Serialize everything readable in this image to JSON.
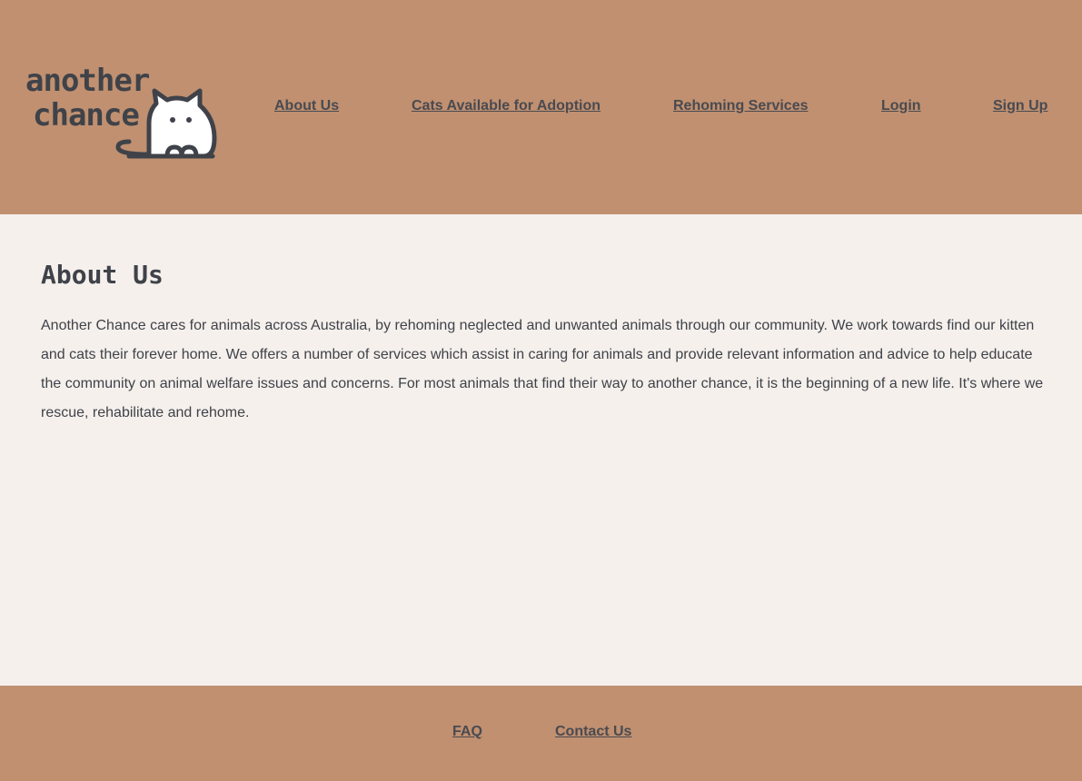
{
  "header": {
    "logo": {
      "line1": "another",
      "line2": "chance",
      "icon": "cat-icon"
    },
    "nav": [
      {
        "label": "About Us"
      },
      {
        "label": "Cats Available for Adoption"
      },
      {
        "label": "Rehoming Services"
      },
      {
        "label": "Login"
      },
      {
        "label": "Sign Up"
      }
    ]
  },
  "main": {
    "title": "About Us",
    "text": "Another Chance cares for animals across Australia, by rehoming neglected and unwanted animals through our community. We work towards find our kitten and cats their forever home. We offers a number of services which assist in caring for animals and provide relevant information and advice to help educate the community on animal welfare issues and concerns. For most animals that find their way to another chance, it is the beginning of a new life. It's where we rescue, rehabilitate and rehome."
  },
  "footer": {
    "links": [
      {
        "label": "FAQ"
      },
      {
        "label": "Contact Us"
      }
    ]
  },
  "colors": {
    "header_bg": "#c09070",
    "page_bg": "#f5f0ec",
    "text": "#3f4249"
  }
}
